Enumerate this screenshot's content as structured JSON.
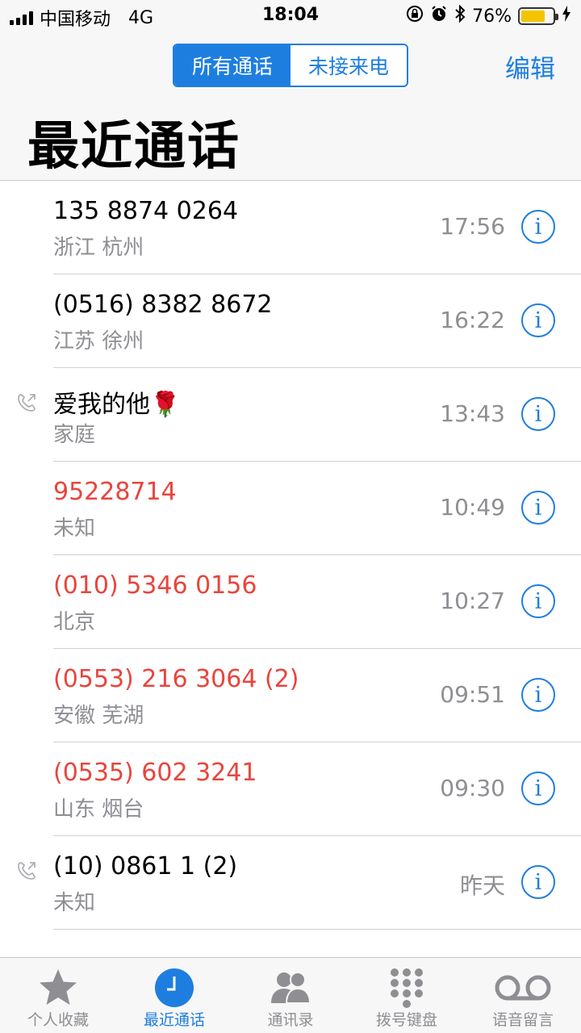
{
  "status_bar": {
    "carrier": "中国移动",
    "network": "4G",
    "time": "18:04",
    "battery": "76%",
    "battery_level": 0.76
  },
  "header": {
    "segments": [
      "所有通话",
      "未接来电"
    ],
    "active_segment": 0,
    "edit_label": "编辑",
    "title": "最近通话"
  },
  "calls": [
    {
      "name": "135 8874 0264",
      "sub": "浙江 杭州",
      "time": "17:56",
      "missed": false,
      "outgoing": false
    },
    {
      "name": "(0516) 8382 8672",
      "sub": "江苏 徐州",
      "time": "16:22",
      "missed": false,
      "outgoing": false
    },
    {
      "name": "爱我的他🌹",
      "sub": "家庭",
      "time": "13:43",
      "missed": false,
      "outgoing": true
    },
    {
      "name": "95228714",
      "sub": "未知",
      "time": "10:49",
      "missed": true,
      "outgoing": false
    },
    {
      "name": "(010) 5346 0156",
      "sub": "北京",
      "time": "10:27",
      "missed": true,
      "outgoing": false
    },
    {
      "name": "(0553) 216 3064 (2)",
      "sub": "安徽 芜湖",
      "time": "09:51",
      "missed": true,
      "outgoing": false
    },
    {
      "name": "(0535) 602 3241",
      "sub": "山东 烟台",
      "time": "09:30",
      "missed": true,
      "outgoing": false
    },
    {
      "name": "(10) 0861 1 (2)",
      "sub": "未知",
      "time": "昨天",
      "missed": false,
      "outgoing": true
    }
  ],
  "tabs": [
    {
      "label": "个人收藏",
      "icon": "star-icon",
      "active": false
    },
    {
      "label": "最近通话",
      "icon": "clock-icon",
      "active": true
    },
    {
      "label": "通讯录",
      "icon": "contacts-icon",
      "active": false
    },
    {
      "label": "拨号键盘",
      "icon": "keypad-icon",
      "active": false
    },
    {
      "label": "语音留言",
      "icon": "voicemail-icon",
      "active": false
    }
  ],
  "colors": {
    "accent": "#1e7ee0",
    "missed": "#e8453c",
    "battery": "#f5c400"
  }
}
